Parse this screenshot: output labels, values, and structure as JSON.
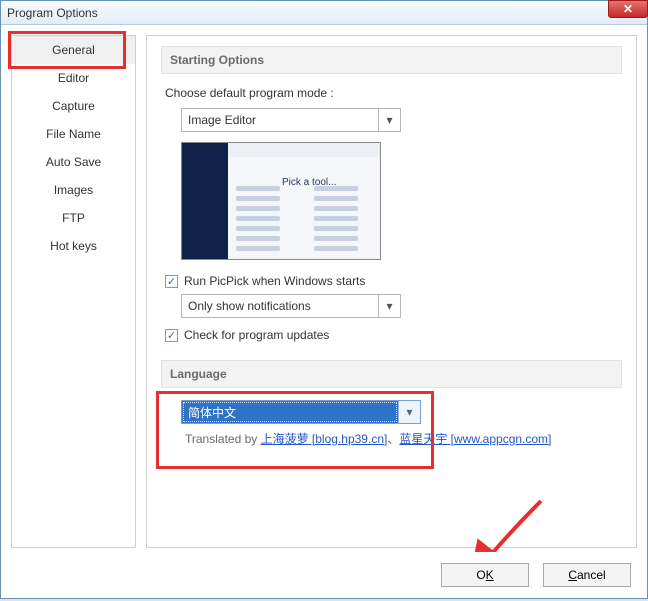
{
  "window": {
    "title": "Program Options"
  },
  "sidebar": {
    "items": [
      {
        "label": "General"
      },
      {
        "label": "Editor"
      },
      {
        "label": "Capture"
      },
      {
        "label": "File Name"
      },
      {
        "label": "Auto Save"
      },
      {
        "label": "Images"
      },
      {
        "label": "FTP"
      },
      {
        "label": "Hot keys"
      }
    ]
  },
  "starting": {
    "group_title": "Starting Options",
    "choose_label": "Choose default program mode :",
    "mode_select": "Image Editor",
    "run_on_start_label": "Run PicPick when Windows starts",
    "run_on_start_checked": true,
    "notify_select": "Only show notifications",
    "check_updates_label": "Check for program updates",
    "check_updates_checked": true
  },
  "language": {
    "group_title": "Language",
    "select_value": "简体中文",
    "translated_prefix": "Translated by ",
    "link1_text": "上海菠萝 [blog.hp39.cn]",
    "sep": "、",
    "link2_text": "蓝星天宇 [www.appcgn.com]"
  },
  "preview": {
    "heading": "Pick a tool..."
  },
  "footer": {
    "ok_prefix": "O",
    "ok_underline": "K",
    "cancel_prefix": "",
    "cancel_underline": "C",
    "cancel_rest": "ancel"
  }
}
